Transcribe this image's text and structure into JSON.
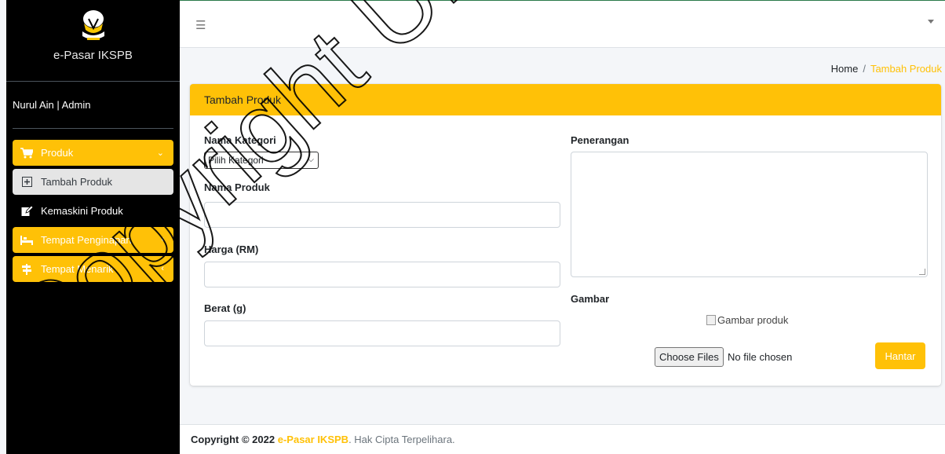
{
  "sidebar": {
    "brand": "e-Pasar IKSPB",
    "user": "Nurul Ain | Admin",
    "items": [
      {
        "label": "Produk",
        "icon": "shopping-cart-icon"
      },
      {
        "label": "Tambah Produk",
        "icon": "plus-square-icon"
      },
      {
        "label": "Kemaskini Produk",
        "icon": "edit-icon"
      },
      {
        "label": "Tempat Penginapan",
        "icon": "bed-icon"
      },
      {
        "label": "Tempat Menarik",
        "icon": "signpost-icon"
      }
    ]
  },
  "topbar": {
    "menu_icon": "hamburger-icon"
  },
  "breadcrumb": {
    "home": "Home",
    "separator": "/",
    "current": "Tambah Produk"
  },
  "form": {
    "title": "Tambah Produk",
    "category_label": "Nama Kategori",
    "category_selected": "Pilih Kategori",
    "product_name_label": "Nama Produk",
    "price_label": "Harga (RM)",
    "weight_label": "Berat (g)",
    "description_label": "Penerangan",
    "image_label": "Gambar",
    "image_alt": "Gambar produk",
    "file_button": "Choose Files",
    "file_status": "No file chosen",
    "submit_label": "Hantar"
  },
  "footer": {
    "prefix": "Copyright © 2022",
    "brand": "e-Pasar IKSPB",
    "suffix": ". Hak Cipta Terpelihara."
  },
  "watermark": {
    "text": "Copyright UKM"
  },
  "colors": {
    "accent": "#ffc107",
    "sidebar": "#000000",
    "background": "#f4f6f9"
  }
}
